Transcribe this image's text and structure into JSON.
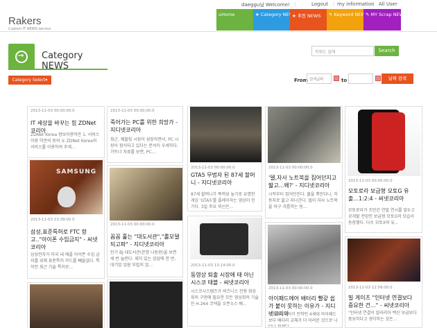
{
  "topbar": {
    "welcome": "daeggu님 Welcome!",
    "logout": "Logout",
    "my_info": "my information",
    "all_user": "All User"
  },
  "logo": {
    "title": "Rakers",
    "subtitle": "Custom IT NEWS service"
  },
  "nav": [
    {
      "label": "Home",
      "icon": "home-icon",
      "color": "#6db33f"
    },
    {
      "label": "Category NEWS",
      "icon": "star-icon",
      "color": "#2e9be0"
    },
    {
      "label": "추천 NEWS",
      "icon": "star-icon",
      "color": "#e8531e"
    },
    {
      "label": "Keyword NEWS",
      "icon": "pencil-icon",
      "color": "#f2a20c"
    },
    {
      "label": "MY Scrap NEWS",
      "icon": "pencil-icon",
      "color": "#a020c0"
    }
  ],
  "category": {
    "title": "Category NEWS",
    "select_label": "Category Select▾"
  },
  "search": {
    "placeholder": "키워드 검색",
    "button": "Search"
  },
  "date_filter": {
    "from": "From",
    "to": "to",
    "start_placeholder": "검색날짜",
    "button": "날짜 검색"
  },
  "colors": {
    "green": "#6db33f",
    "orange": "#e8531e"
  },
  "cards": [
    {
      "date": "2013-11-03 00:00:00.0",
      "title": "IT 세상을 바꾸는 힘 ZDNet 코리아",
      "desc": "ZDNet Korea 정보이용약관 1. 서비스 이용 약관의 동의 ① ZDNet Korea의 서비스를 이용하여 주세..."
    },
    {
      "date": "",
      "title": "삼성,표준특허로 FTC 항고..\"아이폰 수입금지\" - 씨넷코리아",
      "desc": "삼성전자가 미국 내 애플 아이폰 수입 금지를 위해 표준특허 카드를 빼들었다. 특허전 최근 기술 특허로..."
    },
    {
      "date": "",
      "title": "",
      "desc": ""
    },
    {
      "date": "2013-11-03 00:00:00.0",
      "title": "죽어가는 PC를 위한 희망가 - 지디넷코리아",
      "desc": "최근, 웨블릿 시장이 성장하면서, PC 시장이 잠식되고 있다는 분석이 우세하다. 가트너 자료를 보면, PC..."
    },
    {
      "date": "2013-11-03 00:00:00.0",
      "title": "꼼꼼 훑는 \"대도서관\",\"롤모델 되고파\" - 지디넷코리아",
      "desc": "인기 BJ 대도서관(본명 나동현)을 보면 세 번 놀란다. 재치 있는 입담에 한 번, 대기업 임원 부럽지 않..."
    },
    {
      "date": "",
      "title": "",
      "desc": ""
    },
    {
      "date": "2013-11-03 00:00:00.0",
      "title": "GTA5 무법자 된 87세 할머니 - 지디넷코리아",
      "desc": "87세 할머니가 폭력성 높기로 유명한 게임 'GTA5'를 플레이하는 영상이 인기다. 3일 주요 외신은..."
    },
    {
      "date": "2013-11-03 13:14:00.0",
      "title": "동영상 퇴출 시장에 태 아닌 시스코 태블 - 씨넷코리아",
      "desc": "시스코시스템즈가 비즈니스 전용 화상 회의 구현에 필요한 모든 영상회의 기술인 H.264 코덱을 오픈소스 배..."
    },
    {
      "date": "2013-11-03 00:00:00.0",
      "title": "'델,자사 노트북을 집어던지고 밟고...왜?' - 지디넷코리아",
      "desc": "시작부터 집어던진다. 물을 뿌린다니, 자동차로 밟고 지나간다. 델이 자사 노트북을 마구 괴롭히는 동..."
    },
    {
      "date": "2013-11-03 00:00:00.0",
      "title": "아이패드에어 배터리 빨갛 쉽 가 붙이 못하는 이유가 - 지디넷코리아",
      "desc": "아이패드에어가 전작인 4세대 아이패드보다 배터리 교체가 더 어려운 것으로 나타나 화제다..."
    },
    {
      "date": "2013-11-03 00:00:00.0",
      "title": "모토로라 보급형 모토G 유출...1:2:4 - 씨넷코리아",
      "desc": "모토로라가 조만간 연말 연시를 앞두고 공개할 전망인 보급형 모토G의 모습이 등장했다. 다수 모토X와 유..."
    },
    {
      "date": "2013-11-03 12:56:00.0",
      "title": "빌 게이츠 \"인터넷 연결보다 중요한 건...\" - 씨넷코리아",
      "desc": "\"인터넷 연결이 말라리아 백신 보급보다 중요하다고 생각하는 것은..."
    }
  ],
  "image_labels": {
    "samsung": "SAMSUNG"
  }
}
